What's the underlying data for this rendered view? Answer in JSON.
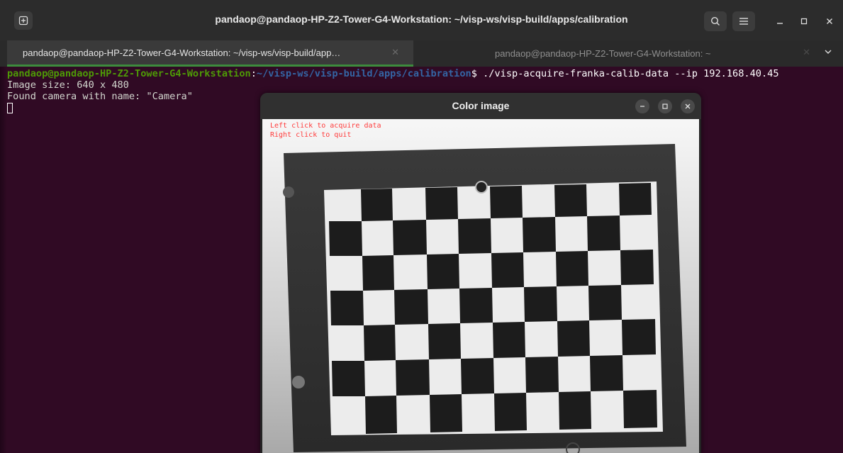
{
  "terminal": {
    "window_title": "pandaop@pandaop-HP-Z2-Tower-G4-Workstation: ~/visp-ws/visp-build/apps/calibration",
    "tabs": [
      {
        "label": "pandaop@pandaop-HP-Z2-Tower-G4-Workstation: ~/visp-ws/visp-build/app…",
        "active": true
      },
      {
        "label": "pandaop@pandaop-HP-Z2-Tower-G4-Workstation: ~",
        "active": false
      }
    ],
    "prompt_user": "pandaop@pandaop-HP-Z2-Tower-G4-Workstation",
    "prompt_sep": ":",
    "prompt_path": "~/visp-ws/visp-build/apps/calibration",
    "prompt_symbol": "$",
    "command": " ./visp-acquire-franka-calib-data --ip 192.168.40.45",
    "output_lines": [
      "Image size: 640 x 480",
      "Found camera with name: \"Camera\""
    ]
  },
  "image_window": {
    "title": "Color image",
    "overlay_lines": [
      "Left click to acquire data",
      "Right click to quit"
    ]
  },
  "colors": {
    "terminal_bg": "#300a24",
    "prompt_user": "#4e9a06",
    "prompt_path": "#3465a4",
    "overlay_text": "#ff3b3b",
    "active_tab_underline": "#3d8b3d"
  },
  "icons": {
    "new_tab": "new-tab-icon",
    "search": "search-icon",
    "menu": "hamburger-menu-icon",
    "minimize": "minimize-icon",
    "maximize": "maximize-icon",
    "close": "close-icon",
    "tab_overflow": "chevron-down-icon"
  }
}
